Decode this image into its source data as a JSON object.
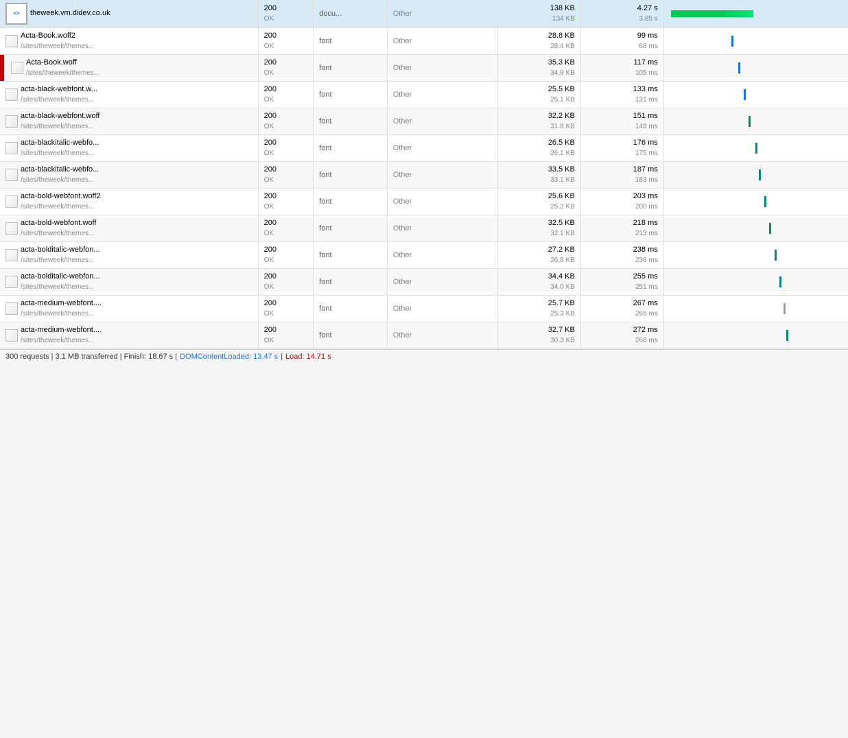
{
  "table": {
    "rows": [
      {
        "id": "row-0",
        "selected": true,
        "hasRedBookmark": false,
        "icon": "html",
        "name": "theweek.vm.didev.co.uk",
        "path": "",
        "statusCode": "200",
        "statusText": "OK",
        "type": "docu...",
        "initiator": "Other",
        "sizeTop": "138 KB",
        "sizeBottom": "134 KB",
        "timeTop": "4.27 s",
        "timeBottom": "3.85 s",
        "waterfall": "bar",
        "barLeft": 2,
        "barWidth": 120,
        "barColor": "green"
      },
      {
        "id": "row-1",
        "selected": false,
        "hasRedBookmark": false,
        "icon": "square",
        "name": "Acta-Book.woff2",
        "path": "/sites/theweek/themes...",
        "statusCode": "200",
        "statusText": "OK",
        "type": "font",
        "initiator": "Other",
        "sizeTop": "28.8 KB",
        "sizeBottom": "28.4 KB",
        "timeTop": "99 ms",
        "timeBottom": "68 ms",
        "waterfall": "tick",
        "tickLeft": 90,
        "tickColor": "blue"
      },
      {
        "id": "row-2",
        "selected": false,
        "hasRedBookmark": true,
        "icon": "square",
        "name": "Acta-Book.woff",
        "path": "/sites/theweek/themes...",
        "statusCode": "200",
        "statusText": "OK",
        "type": "font",
        "initiator": "Other",
        "sizeTop": "35.3 KB",
        "sizeBottom": "34.9 KB",
        "timeTop": "117 ms",
        "timeBottom": "105 ms",
        "waterfall": "tick",
        "tickLeft": 100,
        "tickColor": "blue"
      },
      {
        "id": "row-3",
        "selected": false,
        "hasRedBookmark": false,
        "icon": "square",
        "name": "acta-black-webfont.w...",
        "path": "/sites/theweek/themes...",
        "statusCode": "200",
        "statusText": "OK",
        "type": "font",
        "initiator": "Other",
        "sizeTop": "25.5 KB",
        "sizeBottom": "25.1 KB",
        "timeTop": "133 ms",
        "timeBottom": "131 ms",
        "waterfall": "tick",
        "tickLeft": 108,
        "tickColor": "blue"
      },
      {
        "id": "row-4",
        "selected": false,
        "hasRedBookmark": false,
        "icon": "square",
        "name": "acta-black-webfont.woff",
        "path": "/sites/theweek/themes...",
        "statusCode": "200",
        "statusText": "OK",
        "type": "font",
        "initiator": "Other",
        "sizeTop": "32.2 KB",
        "sizeBottom": "31.8 KB",
        "timeTop": "151 ms",
        "timeBottom": "148 ms",
        "waterfall": "tick",
        "tickLeft": 115,
        "tickColor": "teal"
      },
      {
        "id": "row-5",
        "selected": false,
        "hasRedBookmark": false,
        "icon": "square",
        "name": "acta-blackitalic-webfo...",
        "path": "/sites/theweek/themes...",
        "statusCode": "200",
        "statusText": "OK",
        "type": "font",
        "initiator": "Other",
        "sizeTop": "26.5 KB",
        "sizeBottom": "26.1 KB",
        "timeTop": "176 ms",
        "timeBottom": "175 ms",
        "waterfall": "tick",
        "tickLeft": 125,
        "tickColor": "teal"
      },
      {
        "id": "row-6",
        "selected": false,
        "hasRedBookmark": false,
        "icon": "square",
        "name": "acta-blackitalic-webfo...",
        "path": "/sites/theweek/themes...",
        "statusCode": "200",
        "statusText": "OK",
        "type": "font",
        "initiator": "Other",
        "sizeTop": "33.5 KB",
        "sizeBottom": "33.1 KB",
        "timeTop": "187 ms",
        "timeBottom": "183 ms",
        "waterfall": "tick",
        "tickLeft": 130,
        "tickColor": "teal"
      },
      {
        "id": "row-7",
        "selected": false,
        "hasRedBookmark": false,
        "icon": "square",
        "name": "acta-bold-webfont.woff2",
        "path": "/sites/theweek/themes...",
        "statusCode": "200",
        "statusText": "OK",
        "type": "font",
        "initiator": "Other",
        "sizeTop": "25.6 KB",
        "sizeBottom": "25.2 KB",
        "timeTop": "203 ms",
        "timeBottom": "200 ms",
        "waterfall": "tick",
        "tickLeft": 138,
        "tickColor": "teal"
      },
      {
        "id": "row-8",
        "selected": false,
        "hasRedBookmark": false,
        "icon": "square",
        "name": "acta-bold-webfont.woff",
        "path": "/sites/theweek/themes...",
        "statusCode": "200",
        "statusText": "OK",
        "type": "font",
        "initiator": "Other",
        "sizeTop": "32.5 KB",
        "sizeBottom": "32.1 KB",
        "timeTop": "218 ms",
        "timeBottom": "213 ms",
        "waterfall": "tick",
        "tickLeft": 145,
        "tickColor": "teal"
      },
      {
        "id": "row-9",
        "selected": false,
        "hasRedBookmark": false,
        "icon": "square",
        "name": "acta-bolditalic-webfon...",
        "path": "/sites/theweek/themes...",
        "statusCode": "200",
        "statusText": "OK",
        "type": "font",
        "initiator": "Other",
        "sizeTop": "27.2 KB",
        "sizeBottom": "26.8 KB",
        "timeTop": "238 ms",
        "timeBottom": "236 ms",
        "waterfall": "tick",
        "tickLeft": 153,
        "tickColor": "teal"
      },
      {
        "id": "row-10",
        "selected": false,
        "hasRedBookmark": false,
        "icon": "square",
        "name": "acta-bolditalic-webfon...",
        "path": "/sites/theweek/themes...",
        "statusCode": "200",
        "statusText": "OK",
        "type": "font",
        "initiator": "Other",
        "sizeTop": "34.4 KB",
        "sizeBottom": "34.0 KB",
        "timeTop": "255 ms",
        "timeBottom": "251 ms",
        "waterfall": "tick",
        "tickLeft": 160,
        "tickColor": "teal"
      },
      {
        "id": "row-11",
        "selected": false,
        "hasRedBookmark": false,
        "icon": "square",
        "name": "acta-medium-webfont....",
        "path": "/sites/theweek/themes...",
        "statusCode": "200",
        "statusText": "OK",
        "type": "font",
        "initiator": "Other",
        "sizeTop": "25.7 KB",
        "sizeBottom": "25.3 KB",
        "timeTop": "267 ms",
        "timeBottom": "265 ms",
        "waterfall": "tick",
        "tickLeft": 166,
        "tickColor": "gray"
      },
      {
        "id": "row-12",
        "selected": false,
        "hasRedBookmark": false,
        "icon": "square",
        "name": "acta-medium-webfont....",
        "path": "/sites/theweek/themes...",
        "statusCode": "200",
        "statusText": "OK",
        "type": "font",
        "initiator": "Other",
        "sizeTop": "32.7 KB",
        "sizeBottom": "30.3 KB",
        "timeTop": "272 ms",
        "timeBottom": "268 ms",
        "waterfall": "tick",
        "tickLeft": 170,
        "tickColor": "teal"
      }
    ],
    "statusBar": {
      "text": "300 requests | 3.1 MB transferred | Finish: 18.67 s | ",
      "domContentLabel": "DOMContentLoaded: 13.47 s",
      "loadLabel": "Load: 14.71 s"
    }
  }
}
